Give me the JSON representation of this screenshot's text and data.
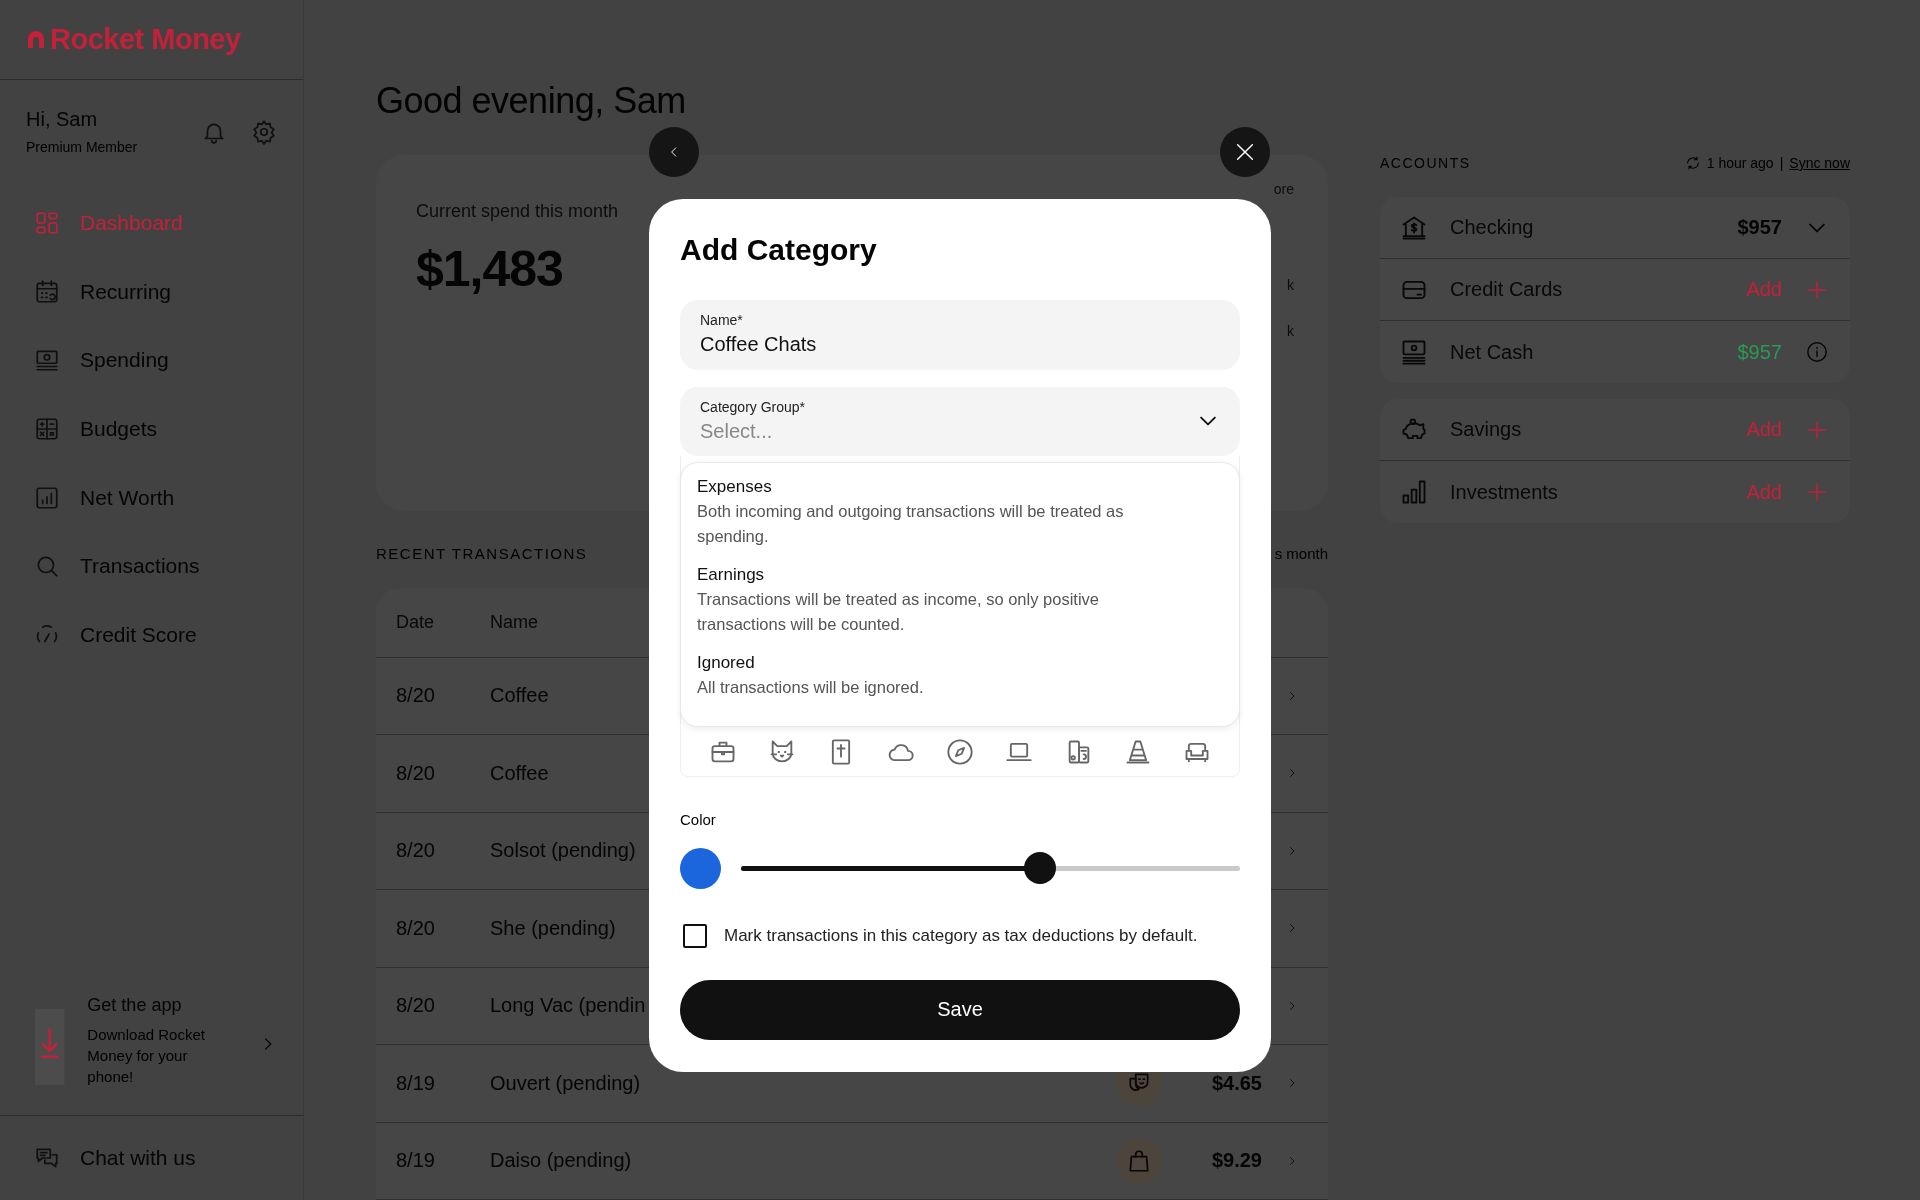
{
  "sidebar": {
    "logo": "Rocket Money",
    "greeting": "Hi, Sam",
    "membership": "Premium Member",
    "nav": [
      {
        "label": "Dashboard",
        "selected": true
      },
      {
        "label": "Recurring",
        "selected": false
      },
      {
        "label": "Spending",
        "selected": false
      },
      {
        "label": "Budgets",
        "selected": false
      },
      {
        "label": "Net Worth",
        "selected": false
      },
      {
        "label": "Transactions",
        "selected": false
      },
      {
        "label": "Credit Score",
        "selected": false
      }
    ],
    "promo": {
      "title": "Get the app",
      "text": "Download Rocket Money for your phone!"
    },
    "chat": "Chat with us"
  },
  "main": {
    "greeting": "Good evening, Sam",
    "spend_card": {
      "label": "Current spend this month",
      "amount": "$1,483",
      "fragments": [
        "ore",
        "k",
        "k"
      ]
    },
    "transactions": {
      "title": "RECENT TRANSACTIONS",
      "header_fragment": "s month",
      "columns": [
        "Date",
        "Name"
      ],
      "rows": [
        {
          "date": "8/20",
          "name": "Coffee"
        },
        {
          "date": "8/20",
          "name": "Coffee"
        },
        {
          "date": "8/20",
          "name": "Solsot (pending)"
        },
        {
          "date": "8/20",
          "name": "She (pending)"
        },
        {
          "date": "8/20",
          "name": "Long Vac (pendin"
        },
        {
          "date": "8/19",
          "name": "Ouvert (pending)",
          "amount": "$4.65"
        },
        {
          "date": "8/19",
          "name": "Daiso (pending)",
          "amount": "$9.29"
        }
      ]
    }
  },
  "accounts": {
    "title": "ACCOUNTS",
    "sync_status": "1 hour ago",
    "separator": "|",
    "sync_link": "Sync now",
    "groups": [
      [
        {
          "name": "Checking",
          "kind": "balance",
          "value": "$957"
        },
        {
          "name": "Credit Cards",
          "kind": "add",
          "value": "Add"
        },
        {
          "name": "Net Cash",
          "kind": "net",
          "value": "$957"
        }
      ],
      [
        {
          "name": "Savings",
          "kind": "add",
          "value": "Add"
        },
        {
          "name": "Investments",
          "kind": "add",
          "value": "Add"
        }
      ]
    ]
  },
  "modal": {
    "title": "Add Category",
    "name_field": {
      "label": "Name*",
      "value": "Coffee Chats"
    },
    "group_field": {
      "label": "Category Group*",
      "placeholder": "Select...",
      "expanded": true
    },
    "options": [
      {
        "title": "Expenses",
        "description": "Both incoming and outgoing transactions will be treated as spending.",
        "selected": false
      },
      {
        "title": "Earnings",
        "description": "Transactions will be treated as income, so only positive transactions will be counted.",
        "selected": false
      },
      {
        "title": "Ignored",
        "description": "All transactions will be ignored.",
        "selected": false
      }
    ],
    "color": {
      "label": "Color",
      "color": "#1b66dc",
      "level": 0.6
    },
    "tax_checkbox": {
      "label": "Mark transactions in this category as tax deductions by default.",
      "checked": false
    },
    "save": "Save"
  }
}
